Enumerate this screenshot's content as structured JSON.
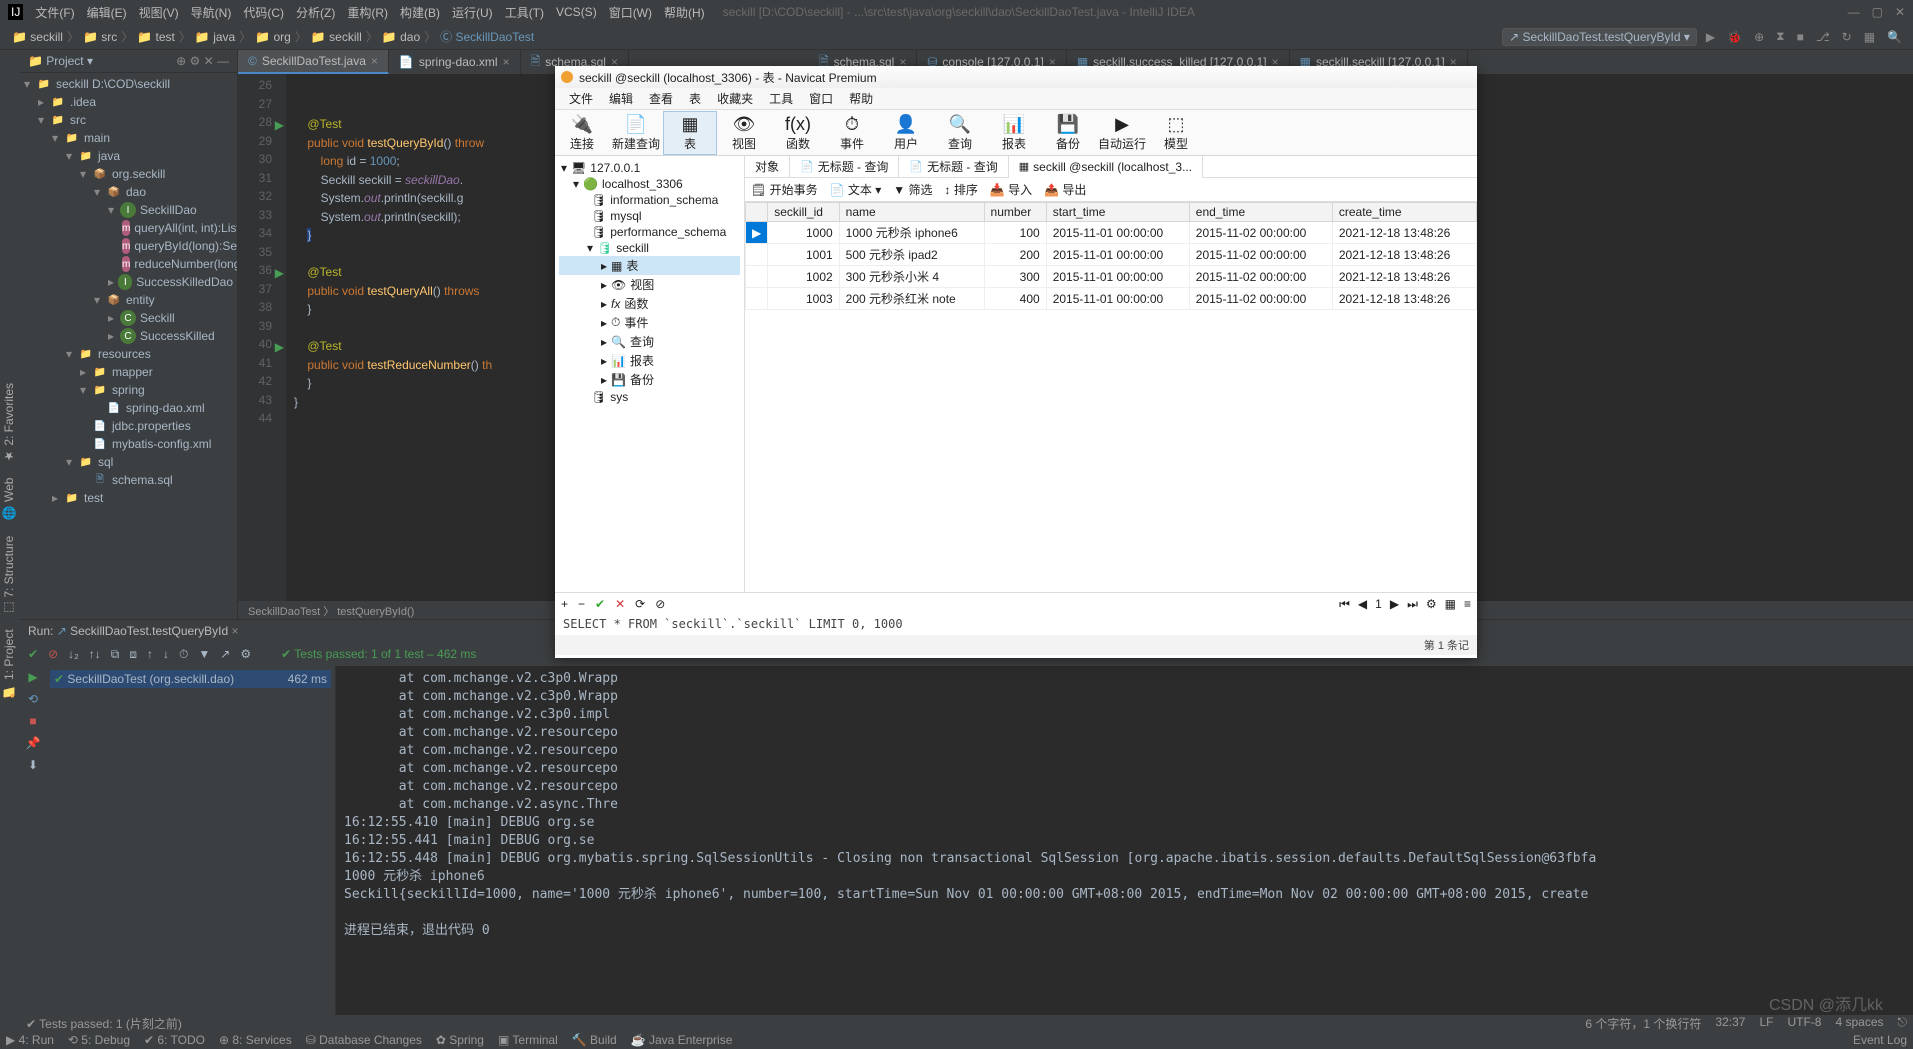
{
  "ij": {
    "menu": [
      "文件(F)",
      "编辑(E)",
      "视图(V)",
      "导航(N)",
      "代码(C)",
      "分析(Z)",
      "重构(R)",
      "构建(B)",
      "运行(U)",
      "工具(T)",
      "VCS(S)",
      "窗口(W)",
      "帮助(H)"
    ],
    "title_path": "seckill [D:\\COD\\seckill] - ...\\src\\test\\java\\org\\seckill\\dao\\SeckillDaoTest.java - IntelliJ IDEA",
    "breadcrumbs": [
      "seckill",
      "src",
      "test",
      "java",
      "org",
      "seckill",
      "dao",
      "SeckillDaoTest"
    ],
    "run_config": "SeckillDaoTest.testQueryById",
    "project_label": "Project",
    "tree": {
      "root": "seckill D:\\COD\\seckill",
      "idea": ".idea",
      "src": "src",
      "main": "main",
      "java": "java",
      "pkg": "org.seckill",
      "dao": "dao",
      "seckill_dao": "SeckillDao",
      "m1": "queryAll(int, int):List<S",
      "m2": "queryById(long):Seckill",
      "m3": "reduceNumber(long, D",
      "skd": "SuccessKilledDao",
      "entity": "entity",
      "e1": "Seckill",
      "e2": "SuccessKilled",
      "resources": "resources",
      "mapper": "mapper",
      "spring": "spring",
      "spring_dao": "spring-dao.xml",
      "jdbc": "jdbc.properties",
      "mybatis": "mybatis-config.xml",
      "sql": "sql",
      "schema": "schema.sql",
      "test": "test"
    },
    "editor_tabs": [
      {
        "label": "SeckillDaoTest.java",
        "active": true,
        "icon": "java"
      },
      {
        "label": "spring-dao.xml",
        "active": false,
        "icon": "xml"
      },
      {
        "label": "schema.sql",
        "active": false,
        "icon": "sql"
      },
      {
        "label": "schema.sql",
        "active": false,
        "icon": "sql"
      },
      {
        "label": "console [127.0.0.1]",
        "active": false,
        "icon": "db"
      },
      {
        "label": "seckill.success_killed [127.0.0.1]",
        "active": false,
        "icon": "tbl"
      },
      {
        "label": "seckill.seckill [127.0.0.1]",
        "active": false,
        "icon": "tbl"
      }
    ],
    "gutter": [
      "26",
      "27",
      "28",
      "29",
      "30",
      "31",
      "32",
      "33",
      "34",
      "35",
      "36",
      "37",
      "38",
      "39",
      "40",
      "41",
      "42",
      "43",
      "44"
    ],
    "breadcrumb_bottom": "SeckillDaoTest 〉 testQueryById()",
    "run_head": "SeckillDaoTest.testQueryById",
    "tests_passed": "Tests passed: 1 of 1 test – 462 ms",
    "test_item": "SeckillDaoTest (org.seckill.dao)",
    "test_time": "462 ms",
    "console_lines": [
      "       at com.mchange.v2.c3p0.Wrapp",
      "       at com.mchange.v2.c3p0.Wrapp",
      "       at com.mchange.v2.c3p0.impl",
      "       at com.mchange.v2.resourcepo",
      "       at com.mchange.v2.resourcepo",
      "       at com.mchange.v2.resourcepo",
      "       at com.mchange.v2.resourcepo",
      "       at com.mchange.v2.async.Thre",
      "16:12:55.410 [main] DEBUG org.se",
      "16:12:55.441 [main] DEBUG org.se",
      "16:12:55.448 [main] DEBUG org.mybatis.spring.SqlSessionUtils - Closing non transactional SqlSession [org.apache.ibatis.session.defaults.DefaultSqlSession@63fbfa",
      "1000 元秒杀 iphone6",
      "Seckill{seckillId=1000, name='1000 元秒杀 iphone6', number=100, startTime=Sun Nov 01 00:00:00 GMT+08:00 2015, endTime=Mon Nov 02 00:00:00 GMT+08:00 2015, create",
      "",
      "进程已结束，退出代码 0"
    ],
    "bottom_tools": [
      "▶ 4: Run",
      "⟲ 5: Debug",
      "✔ 6: TODO",
      "⊕ 8: Services",
      "⛁ Database Changes",
      "✿ Spring",
      "▣ Terminal",
      "🔨 Build",
      "☕ Java Enterprise"
    ],
    "tests_status": "Tests passed: 1 (片刻之前)",
    "status_right": [
      "6 个字符，1 个换行符",
      "32:37",
      "LF",
      "UTF-8",
      "4 spaces",
      "⎋"
    ],
    "run_label": "Run:",
    "event_log": "Event Log"
  },
  "nav": {
    "title": "seckill @seckill (localhost_3306) - 表 - Navicat Premium",
    "menu": [
      "文件",
      "编辑",
      "查看",
      "表",
      "收藏夹",
      "工具",
      "窗口",
      "帮助"
    ],
    "toolbar": [
      {
        "icon": "🔌",
        "label": "连接"
      },
      {
        "icon": "📄",
        "label": "新建查询"
      },
      {
        "icon": "▦",
        "label": "表",
        "active": true
      },
      {
        "icon": "👁",
        "label": "视图"
      },
      {
        "icon": "f(x)",
        "label": "函数"
      },
      {
        "icon": "⏱",
        "label": "事件"
      },
      {
        "icon": "👤",
        "label": "用户"
      },
      {
        "icon": "🔍",
        "label": "查询"
      },
      {
        "icon": "📊",
        "label": "报表"
      },
      {
        "icon": "💾",
        "label": "备份"
      },
      {
        "icon": "▶",
        "label": "自动运行"
      },
      {
        "icon": "⬚",
        "label": "模型"
      }
    ],
    "tree": {
      "root": "127.0.0.1",
      "conn": "localhost_3306",
      "dbs": [
        "information_schema",
        "mysql",
        "performance_schema",
        "seckill"
      ],
      "seckill_children": [
        "表",
        "视图",
        "函数",
        "事件",
        "查询",
        "报表",
        "备份"
      ],
      "sys": "sys"
    },
    "tabs": [
      {
        "label": "对象"
      },
      {
        "label": "无标题 - 查询"
      },
      {
        "label": "无标题 - 查询"
      },
      {
        "label": "seckill @seckill (localhost_3...",
        "active": true
      }
    ],
    "subtool": [
      "开始事务",
      "文本 ▾",
      "筛选",
      "排序",
      "导入",
      "导出"
    ],
    "columns": [
      "seckill_id",
      "name",
      "number",
      "start_time",
      "end_time",
      "create_time"
    ],
    "rows": [
      {
        "id": "1000",
        "name": "1000 元秒杀 iphone6",
        "number": "100",
        "st": "2015-11-01 00:00:00",
        "et": "2015-11-02 00:00:00",
        "ct": "2021-12-18 13:48:26",
        "sel": true
      },
      {
        "id": "1001",
        "name": "500 元秒杀 ipad2",
        "number": "200",
        "st": "2015-11-01 00:00:00",
        "et": "2015-11-02 00:00:00",
        "ct": "2021-12-18 13:48:26"
      },
      {
        "id": "1002",
        "name": "300 元秒杀小米 4",
        "number": "300",
        "st": "2015-11-01 00:00:00",
        "et": "2015-11-02 00:00:00",
        "ct": "2021-12-18 13:48:26"
      },
      {
        "id": "1003",
        "name": "200 元秒杀红米 note",
        "number": "400",
        "st": "2015-11-01 00:00:00",
        "et": "2015-11-02 00:00:00",
        "ct": "2021-12-18 13:48:26"
      }
    ],
    "sql": "SELECT * FROM `seckill`.`seckill` LIMIT 0, 1000",
    "page": "1",
    "status": "第 1 条记"
  },
  "watermark": "CSDN @添几kk"
}
